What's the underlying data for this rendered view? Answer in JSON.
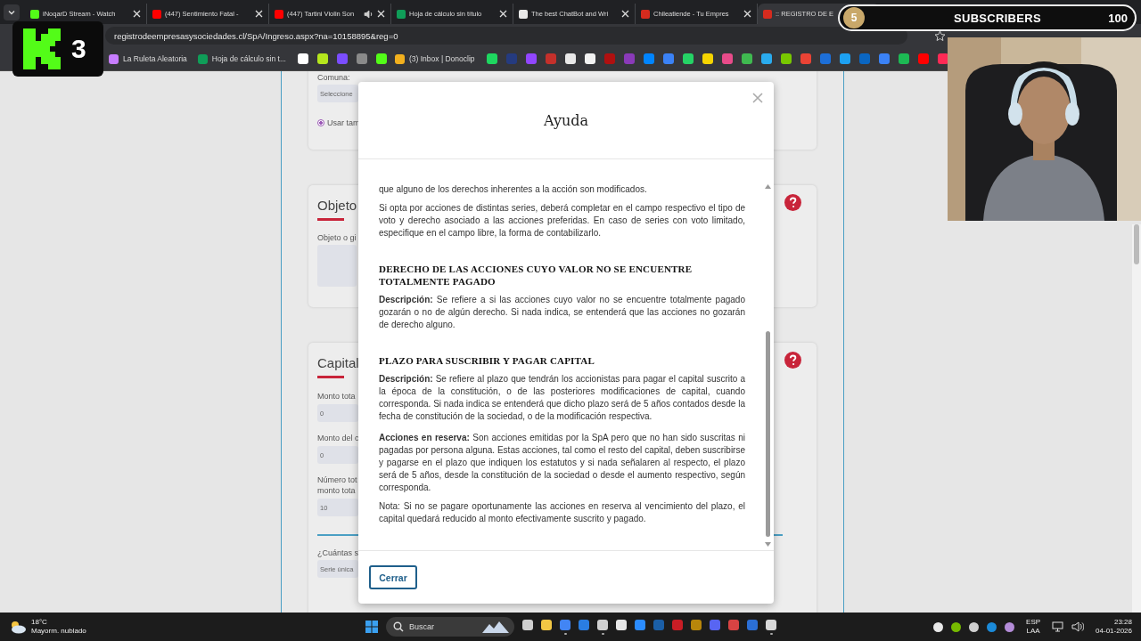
{
  "tabs": [
    {
      "title": "iNoqarD Stream - Watch",
      "color": "#53fc18",
      "selected": false,
      "audio": false
    },
    {
      "title": "(447) Sentimiento Fatal -",
      "color": "#ff0000",
      "selected": false,
      "audio": false
    },
    {
      "title": "(447) Tartini Violin Son",
      "color": "#ff0000",
      "selected": false,
      "audio": true
    },
    {
      "title": "Hoja de cálculo sin título",
      "color": "#0f9d58",
      "selected": false,
      "audio": false
    },
    {
      "title": "The best ChatBot and Wri",
      "color": "#e8e8e8",
      "selected": false,
      "audio": false
    },
    {
      "title": "Chileatiende - Tu Empres",
      "color": "#d52b1e",
      "selected": false,
      "audio": false
    },
    {
      "title": ":: REGISTRO DE E",
      "color": "#d52b1e",
      "selected": true,
      "audio": false
    }
  ],
  "address": {
    "url": "registrodeempresasysociedades.cl/SpA/Ingreso.aspx?na=10158895&reg=0"
  },
  "bookmarks": [
    {
      "kind": "text",
      "label": "La Ruleta Aleatoria",
      "color": "#c77dff"
    },
    {
      "kind": "text",
      "label": "Hoja de cálculo sin t...",
      "color": "#0f9d58"
    },
    {
      "kind": "icon",
      "color": "#ffffff"
    },
    {
      "kind": "icon",
      "color": "#b5e61d"
    },
    {
      "kind": "icon",
      "color": "#7b4dff"
    },
    {
      "kind": "icon",
      "color": "#8a8a8a"
    },
    {
      "kind": "icon",
      "color": "#53fc18"
    },
    {
      "kind": "text",
      "label": "(3) Inbox | Donoclip",
      "color": "#f2b01e"
    },
    {
      "kind": "icon",
      "color": "#1ed760"
    },
    {
      "kind": "icon",
      "color": "#253b80"
    },
    {
      "kind": "icon",
      "color": "#9146ff"
    },
    {
      "kind": "icon",
      "color": "#c4302b"
    },
    {
      "kind": "icon",
      "color": "#e8e8e8"
    },
    {
      "kind": "icon",
      "color": "#f2f2f2"
    },
    {
      "kind": "icon",
      "color": "#b01010"
    },
    {
      "kind": "icon",
      "color": "#8a3ab9"
    },
    {
      "kind": "icon",
      "color": "#0084ff"
    },
    {
      "kind": "icon",
      "color": "#3b82f6"
    },
    {
      "kind": "icon",
      "color": "#25d366"
    },
    {
      "kind": "icon",
      "color": "#f5d400"
    },
    {
      "kind": "icon",
      "color": "#e84b8a"
    },
    {
      "kind": "icon",
      "color": "#3fb950"
    },
    {
      "kind": "icon",
      "color": "#2aabee"
    },
    {
      "kind": "icon",
      "color": "#78c800"
    },
    {
      "kind": "icon",
      "color": "#ea4335"
    },
    {
      "kind": "icon",
      "color": "#1d6fd8"
    },
    {
      "kind": "icon",
      "color": "#1da1f2"
    },
    {
      "kind": "icon",
      "color": "#0a66c2"
    },
    {
      "kind": "icon",
      "color": "#3b82f6"
    },
    {
      "kind": "icon",
      "color": "#1db954"
    },
    {
      "kind": "icon",
      "color": "#ff0000"
    },
    {
      "kind": "icon",
      "color": "#ff2a55"
    }
  ],
  "form": {
    "comuna": {
      "label": "Comuna:",
      "value": "Seleccione"
    },
    "radio": {
      "label": "Usar tam",
      "selected": true
    },
    "objeto": {
      "title": "Objeto",
      "label": "Objeto o gi"
    },
    "capital": {
      "title": "Capital",
      "fields": [
        {
          "label": "Monto tota",
          "value": "0"
        },
        {
          "label": "Monto del c",
          "value": "0"
        },
        {
          "label": "Número tot\nmonto tota",
          "value": "10"
        }
      ],
      "series_label": "¿Cuántas s",
      "series_value": "Serie única"
    }
  },
  "modal": {
    "title": "Ayuda",
    "body": [
      {
        "kind": "p",
        "text": "que alguno de los derechos inherentes a la acción son modificados."
      },
      {
        "kind": "p",
        "text": "Si opta por acciones de distintas series, deberá completar en el campo respectivo el tipo de voto y derecho asociado a las acciones preferidas. En caso de series con voto limitado, especifique en el campo libre, la forma de contabilizarlo."
      },
      {
        "kind": "heading",
        "text": "DERECHO DE LAS ACCIONES CUYO VALOR NO SE ENCUENTRE TOTALMENTE PAGADO"
      },
      {
        "kind": "p",
        "text": "**Descripción:** Se refiere a si las acciones cuyo valor no se encuentre totalmente pagado gozarán o no de algún derecho. Si nada indica, se entenderá que las acciones no gozarán de derecho alguno."
      },
      {
        "kind": "heading",
        "text": "PLAZO PARA SUSCRIBIR Y PAGAR CAPITAL"
      },
      {
        "kind": "p",
        "text": "**Descripción:** Se refiere al plazo que tendrán los accionistas para pagar el capital suscrito a la época de la constitución, o de las posteriores modificaciones de capital, cuando corresponda. Si nada indica se entenderá que dicho plazo será de 5 años contados desde la fecha de constitución de la sociedad, o de la modificación respectiva."
      },
      {
        "kind": "p",
        "text": "**Acciones en reserva:** Son acciones emitidas por la SpA pero que no han sido suscritas ni pagadas por persona alguna. Estas acciones, tal como el resto del capital, deben suscribirse y pagarse en el plazo que indiquen los estatutos y si nada señalaren al respecto, el plazo será de 5 años, desde la constitución de la sociedad o desde el aumento respectivo, según corresponda."
      },
      {
        "kind": "p",
        "text": "Nota: Si no se pagare oportunamente las acciones en reserva al vencimiento del plazo, el capital quedará reducido al monto efectivamente suscrito y pagado."
      }
    ],
    "close_button": "Cerrar"
  },
  "stream_logo": {
    "number": "3"
  },
  "subscribers": {
    "goal_start": "5",
    "label": "SUBSCRIBERS",
    "goal": "100"
  },
  "taskbar": {
    "weather": {
      "temp": "18°C",
      "condition": "Mayorm. nublado"
    },
    "search": {
      "label": "Buscar"
    },
    "apps": [
      {
        "color": "#cfcfcf",
        "running": false
      },
      {
        "color": "#f2c744",
        "running": false
      },
      {
        "color": "#4285f4",
        "running": true
      },
      {
        "color": "#2a7de1",
        "running": false
      },
      {
        "color": "#d0d0d0",
        "running": true
      },
      {
        "color": "#e8e8e8",
        "running": false
      },
      {
        "color": "#2b8cff",
        "running": false
      },
      {
        "color": "#1b5fa6",
        "running": false
      },
      {
        "color": "#c81d25",
        "running": false
      },
      {
        "color": "#b8860b",
        "running": false
      },
      {
        "color": "#5865f2",
        "running": false
      },
      {
        "color": "#d84343",
        "running": false
      },
      {
        "color": "#2b6fd6",
        "running": false
      },
      {
        "color": "#d8d8d8",
        "running": true
      }
    ],
    "tray": [
      {
        "color": "#e8e8e8"
      },
      {
        "color": "#76b900"
      },
      {
        "color": "#cfcfcf"
      },
      {
        "color": "#1b8ad8"
      },
      {
        "color": "#b48cd8"
      }
    ],
    "language": "ESP",
    "layout": "LAA",
    "time": "23:28",
    "date": "04-01-2026"
  }
}
